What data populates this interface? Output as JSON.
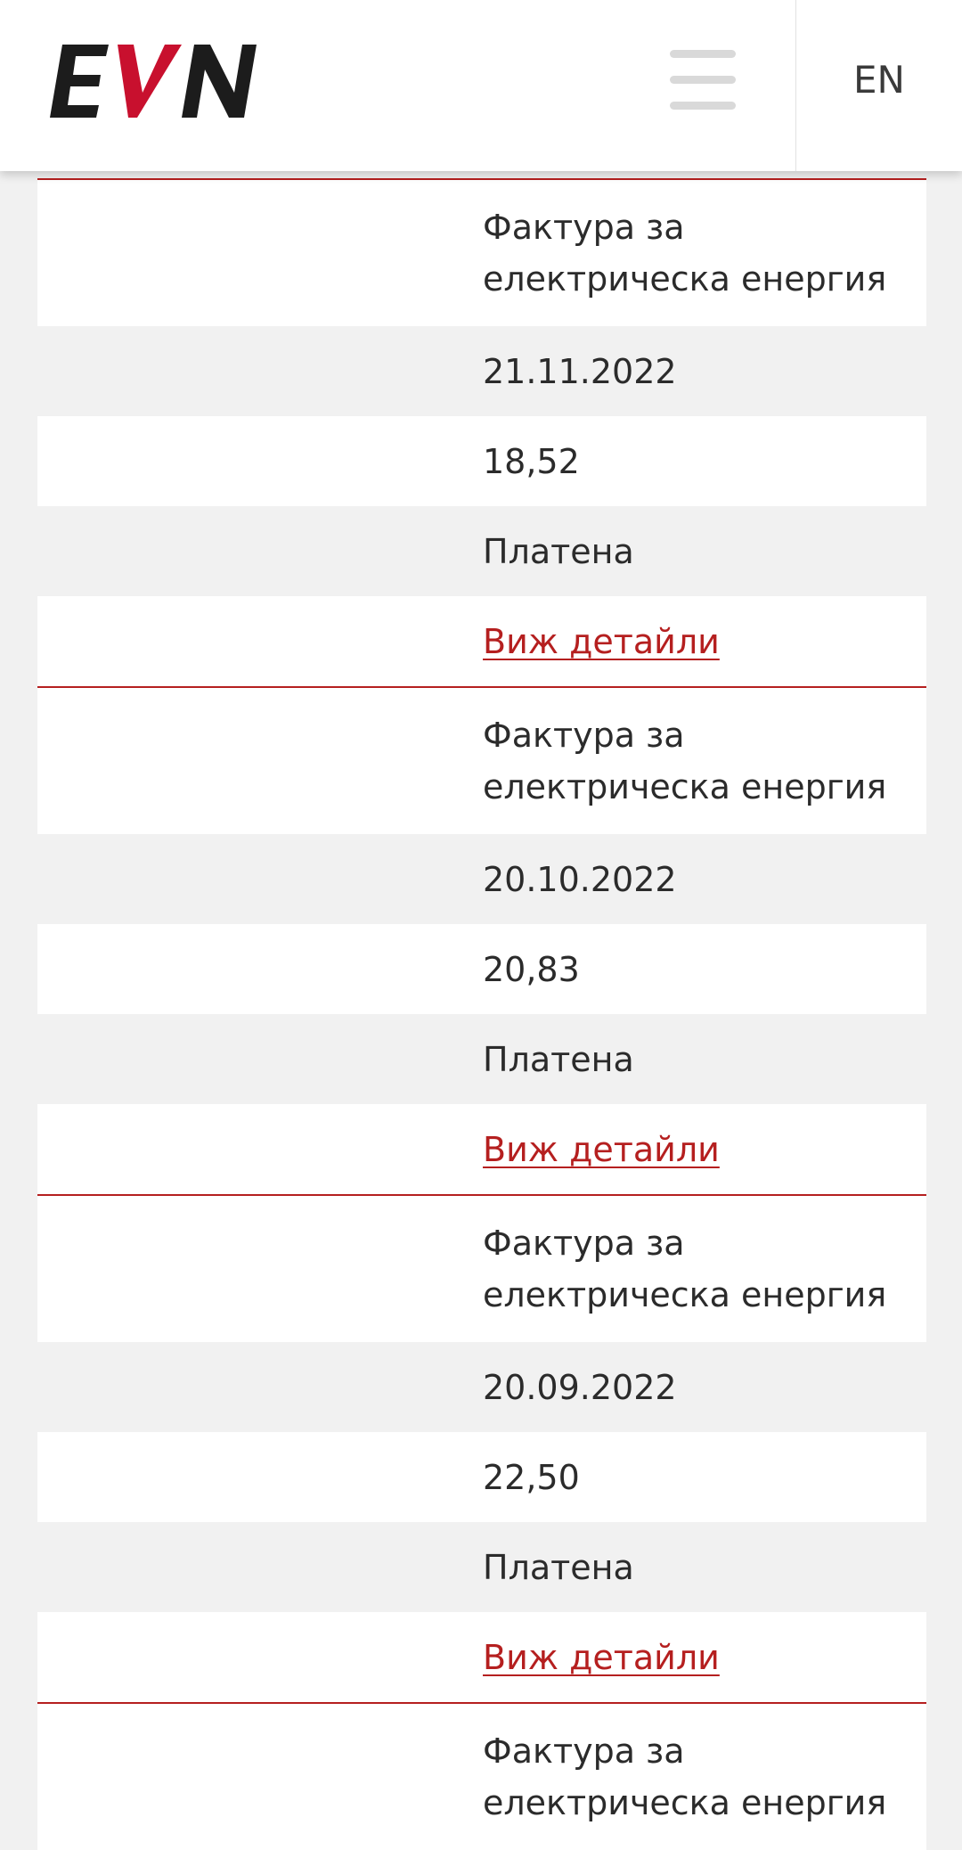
{
  "header": {
    "logo_text": "EVN",
    "logo_colors": {
      "dark": "#1c1c1c",
      "accent": "#c8102e"
    },
    "menu_icon": "hamburger-menu-icon",
    "language_label": "EN"
  },
  "invoices": [
    {
      "type": "Фактура за електрическа енергия",
      "date": "21.11.2022",
      "amount": "18,52",
      "status": "Платена",
      "details_link": "Виж детайли"
    },
    {
      "type": "Фактура за електрическа енергия",
      "date": "20.10.2022",
      "amount": "20,83",
      "status": "Платена",
      "details_link": "Виж детайли"
    },
    {
      "type": "Фактура за електрическа енергия",
      "date": "20.09.2022",
      "amount": "22,50",
      "status": "Платена",
      "details_link": "Виж детайли"
    },
    {
      "type": "Фактура за електрическа енергия"
    }
  ],
  "colors": {
    "accent": "#b51f1f",
    "row_white": "#ffffff",
    "row_grey": "#f1f1f1",
    "text": "#2b2b2b"
  }
}
